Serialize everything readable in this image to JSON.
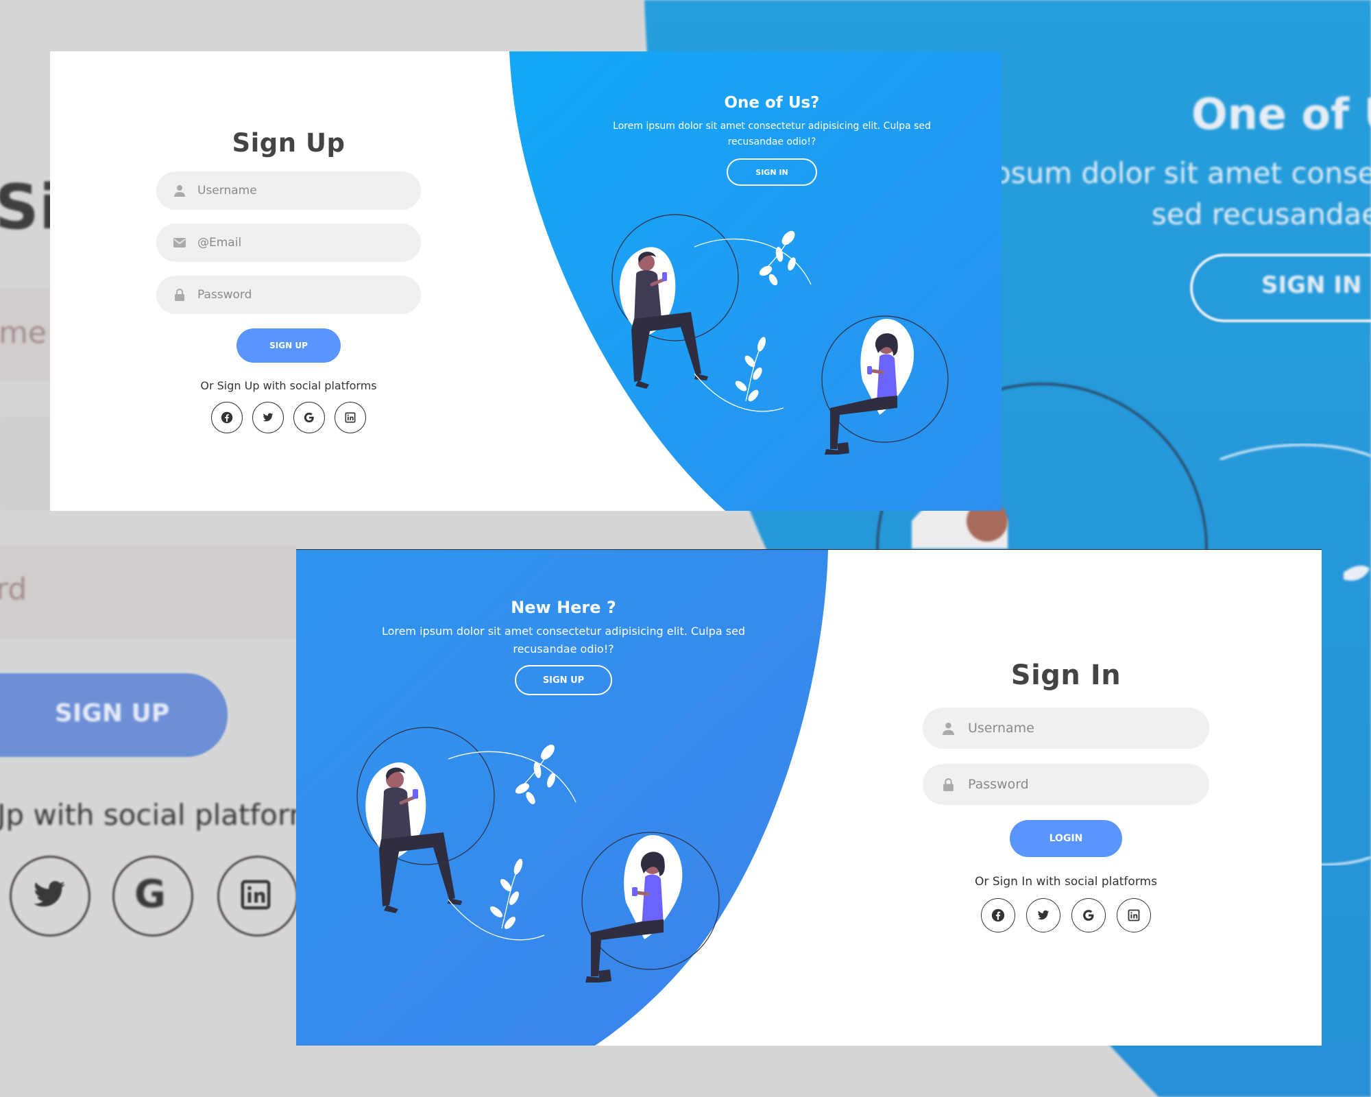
{
  "background": {
    "signup_title_fragment": "Sig",
    "username_fragment": "me",
    "password_fragment": "rd",
    "signup_button": "SIGN UP",
    "social_text_fragment": "Jp with social platform",
    "right_title_fragment": "One of Us",
    "right_text_line1": "psum dolor sit amet consecte",
    "right_text_line2": "sed recusandae",
    "right_button": "SIGN IN"
  },
  "signup_panel": {
    "title": "Sign Up",
    "username_placeholder": "Username",
    "email_placeholder": "@Email",
    "password_placeholder": "Password",
    "submit_label": "SIGN UP",
    "social_text": "Or Sign Up with social platforms",
    "info_title": "One of Us?",
    "info_text": "Lorem ipsum dolor sit amet consectetur adipisicing elit. Culpa sed recusandae odio!?",
    "info_button": "SIGN IN"
  },
  "signin_panel": {
    "title": "Sign In",
    "username_placeholder": "Username",
    "password_placeholder": "Password",
    "submit_label": "LOGIN",
    "social_text": "Or Sign In with social platforms",
    "info_title": "New Here ?",
    "info_text": "Lorem ipsum dolor sit amet consectetur adipisicing elit. Culpa sed recusandae odio!?",
    "info_button": "SIGN UP"
  },
  "social_icons": [
    "facebook-icon",
    "twitter-icon",
    "google-icon",
    "linkedin-icon"
  ],
  "colors": {
    "accent": "#5995fd",
    "gradient_top": "#12a8f8",
    "gradient_bottom": "#3c83ec",
    "field_bg": "#f0f0f0",
    "page_bg": "#d6d6d6",
    "person_shirt": "#6c63ff",
    "person_dark": "#3f3d56"
  }
}
